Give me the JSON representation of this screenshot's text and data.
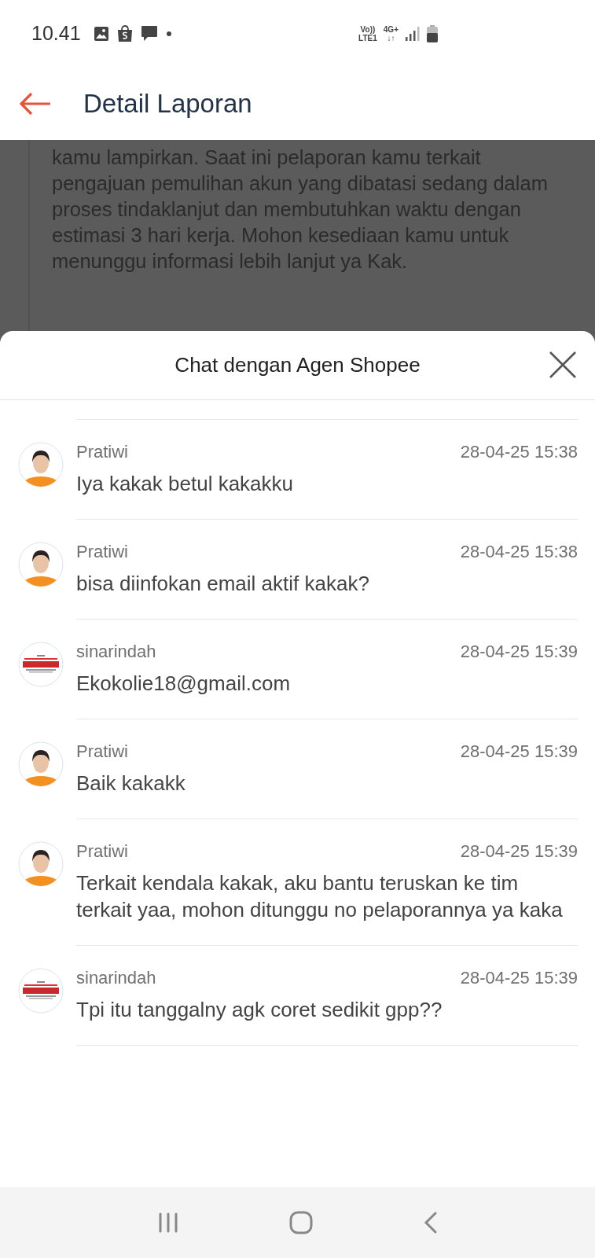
{
  "status_bar": {
    "time": "10.41",
    "volte_top": "Vo))",
    "volte_bottom": "LTE1",
    "network_type": "4G+",
    "network_arrows": "↓↑"
  },
  "app_bar": {
    "title": "Detail Laporan"
  },
  "report": {
    "paragraph": "kamu lampirkan. Saat ini pelaporan kamu terkait pengajuan pemulihan akun yang dibatasi sedang dalam proses tindaklanjut dan membutuhkan waktu dengan estimasi 3 hari kerja. Mohon kesediaan kamu untuk menunggu informasi lebih lanjut ya Kak."
  },
  "chat_sheet": {
    "title": "Chat dengan Agen Shopee",
    "messages": [
      {
        "kind": "agent",
        "sender": "Pratiwi",
        "time": "28-04-25 15:38",
        "text": "Iya kakak betul kakakku"
      },
      {
        "kind": "agent",
        "sender": "Pratiwi",
        "time": "28-04-25 15:38",
        "text": "bisa diinfokan email aktif kakak?"
      },
      {
        "kind": "seller",
        "sender": "sinarindah",
        "time": "28-04-25 15:39",
        "text": "Ekokolie18@gmail.com"
      },
      {
        "kind": "agent",
        "sender": "Pratiwi",
        "time": "28-04-25 15:39",
        "text": "Baik kakakk"
      },
      {
        "kind": "agent",
        "sender": "Pratiwi",
        "time": "28-04-25 15:39",
        "text": "Terkait kendala kakak, aku bantu teruskan ke tim terkait yaa, mohon ditunggu no pelaporannya ya kaka"
      },
      {
        "kind": "seller",
        "sender": "sinarindah",
        "time": "28-04-25 15:39",
        "text": "Tpi itu tanggalny agk coret sedikit gpp??"
      }
    ]
  }
}
